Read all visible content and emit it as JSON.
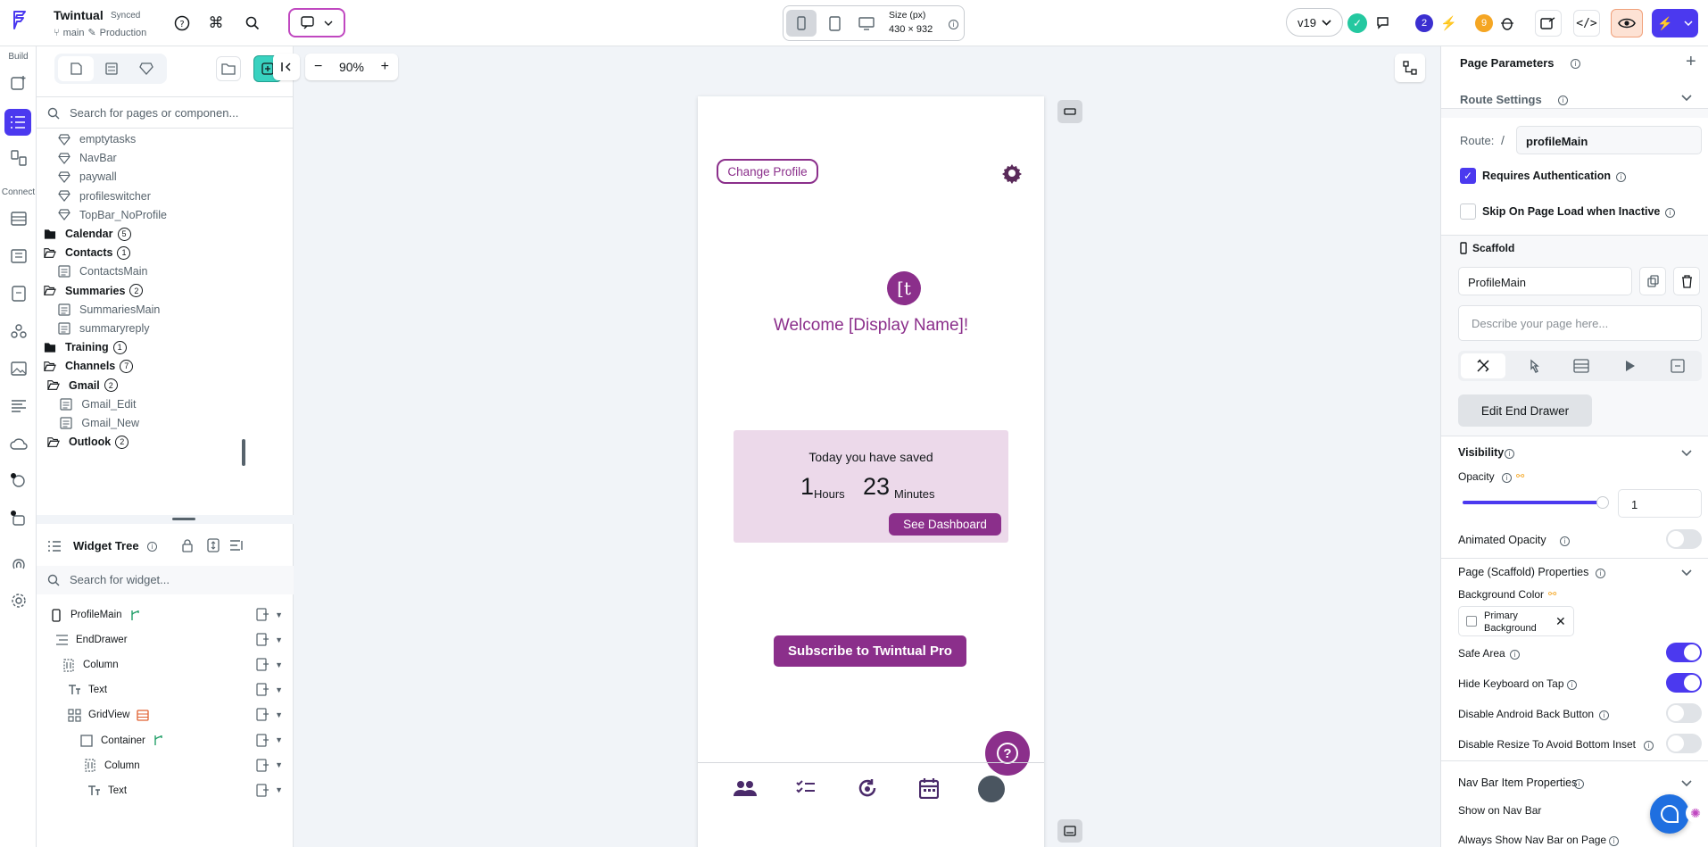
{
  "app": {
    "name": "Twintual",
    "sync_status": "Synced",
    "branch": "main",
    "environment": "Production",
    "version": "v19",
    "size_label": "Size (px)",
    "size_value": "430 × 932",
    "notifications_count": "2",
    "warnings_count": "9"
  },
  "rail": {
    "build_label": "Build",
    "connect_label": "Connect"
  },
  "pages": {
    "search_placeholder": "Search for pages or componen...",
    "items": [
      {
        "label": "emptytasks",
        "kind": "component",
        "indent": 1
      },
      {
        "label": "NavBar",
        "kind": "component",
        "indent": 1
      },
      {
        "label": "paywall",
        "kind": "component",
        "indent": 1
      },
      {
        "label": "profileswitcher",
        "kind": "component",
        "indent": 1
      },
      {
        "label": "TopBar_NoProfile",
        "kind": "component",
        "indent": 1
      },
      {
        "label": "Calendar",
        "kind": "folder-closed",
        "count": "5",
        "indent": 0
      },
      {
        "label": "Contacts",
        "kind": "folder-open",
        "count": "1",
        "indent": 0
      },
      {
        "label": "ContactsMain",
        "kind": "page",
        "indent": 1
      },
      {
        "label": "Summaries",
        "kind": "folder-open",
        "count": "2",
        "indent": 0
      },
      {
        "label": "SummariesMain",
        "kind": "page",
        "indent": 1
      },
      {
        "label": "summaryreply",
        "kind": "page",
        "indent": 1
      },
      {
        "label": "Training",
        "kind": "folder-closed",
        "count": "1",
        "indent": 0
      },
      {
        "label": "Channels",
        "kind": "folder-open",
        "count": "7",
        "indent": 0
      },
      {
        "label": "Gmail",
        "kind": "folder-open",
        "count": "2",
        "indent": 0.5
      },
      {
        "label": "Gmail_Edit",
        "kind": "page",
        "indent": 1.3
      },
      {
        "label": "Gmail_New",
        "kind": "page",
        "indent": 1.3
      },
      {
        "label": "Outlook",
        "kind": "folder-open",
        "count": "2",
        "indent": 0.5
      }
    ]
  },
  "widget_tree": {
    "title": "Widget Tree",
    "search_placeholder": "Search for widget...",
    "rows": [
      {
        "label": "ProfileMain",
        "icon": "phone-icon",
        "depth": 0,
        "extra": "branch"
      },
      {
        "label": "EndDrawer",
        "icon": "drawer-icon",
        "depth": 1
      },
      {
        "label": "Column",
        "icon": "column-icon",
        "depth": 2
      },
      {
        "label": "Text",
        "icon": "text-icon",
        "depth": 3
      },
      {
        "label": "GridView",
        "icon": "grid-icon",
        "depth": 3,
        "extra": "backend"
      },
      {
        "label": "Container",
        "icon": "container-icon",
        "depth": 4,
        "extra": "branch"
      },
      {
        "label": "Column",
        "icon": "column-icon",
        "depth": 5
      },
      {
        "label": "Text",
        "icon": "text-icon",
        "depth": 6
      }
    ]
  },
  "canvas": {
    "zoom": "90%"
  },
  "phone": {
    "change_profile": "Change Profile",
    "avatar_initial": "[t",
    "welcome": "Welcome [Display Name]!",
    "saved_heading": "Today you have saved",
    "hours_value": "1",
    "hours_unit": "Hours",
    "minutes_value": "23",
    "minutes_unit": "Minutes",
    "dashboard_button": "See Dashboard",
    "subscribe_button": "Subscribe to Twintual Pro",
    "help_glyph": "?",
    "colors": {
      "primary": "#8b2f8b",
      "card": "#ecd9ea"
    }
  },
  "right": {
    "page_parameters": "Page Parameters",
    "route_settings": "Route Settings",
    "route_label": "Route:",
    "route_slash": "/",
    "route_value": "profileMain",
    "requires_auth": "Requires Authentication",
    "skip_on_load": "Skip On Page Load when Inactive",
    "scaffold": "Scaffold",
    "scaffold_name": "ProfileMain",
    "describe_placeholder": "Describe your page here...",
    "edit_end_drawer": "Edit End Drawer",
    "visibility": "Visibility",
    "opacity": "Opacity",
    "opacity_value": "1",
    "opacity_level": 1,
    "animated_opacity": "Animated Opacity",
    "scaffold_props": "Page (Scaffold) Properties",
    "background_color": "Background Color",
    "bg_value_line1": "Primary",
    "bg_value_line2": "Background",
    "safe_area": "Safe Area",
    "hide_keyboard": "Hide Keyboard on Tap",
    "disable_back": "Disable Android Back Button",
    "disable_resize": "Disable Resize To Avoid Bottom Inset",
    "navbar_props": "Nav Bar Item Properties",
    "show_on_navbar": "Show on Nav Bar",
    "always_show_navbar": "Always Show Nav Bar on Page",
    "accent": "#4b39ef"
  }
}
